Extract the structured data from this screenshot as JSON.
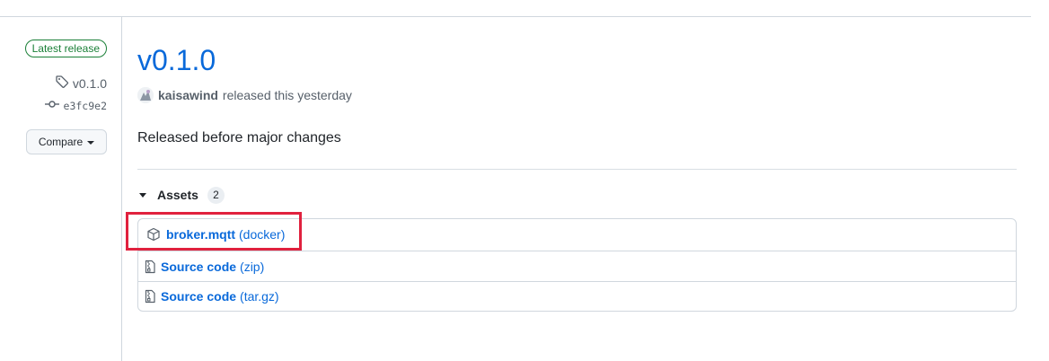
{
  "sidebar": {
    "latest_badge": "Latest release",
    "tag": "v0.1.0",
    "commit": "e3fc9e2",
    "compare_label": "Compare"
  },
  "release": {
    "title": "v0.1.0",
    "author": "kaisawind",
    "released_text": "released this yesterday",
    "notes": "Released before major changes"
  },
  "assets": {
    "label": "Assets",
    "count": "2",
    "items": [
      {
        "name": "broker.mqtt",
        "ext": "(docker)",
        "icon": "package-icon"
      },
      {
        "name": "Source code",
        "ext": "(zip)",
        "icon": "file-zip-icon"
      },
      {
        "name": "Source code",
        "ext": "(tar.gz)",
        "icon": "file-zip-icon"
      }
    ]
  },
  "colors": {
    "link": "#0969da",
    "latest_green": "#1a7f37",
    "highlight": "#e0213e"
  }
}
